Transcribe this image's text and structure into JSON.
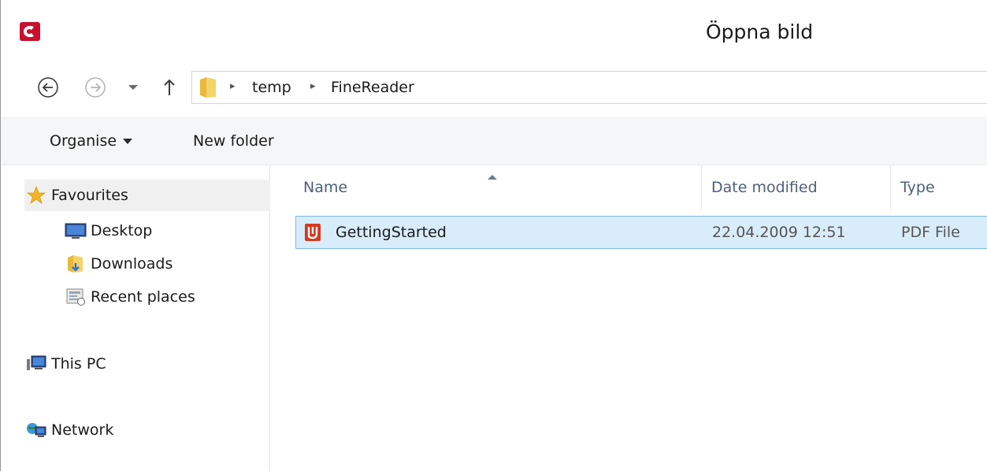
{
  "window": {
    "title": "Öppna bild"
  },
  "address": {
    "crumbs": [
      "temp",
      "FineReader"
    ]
  },
  "toolbar": {
    "organise_label": "Organise",
    "new_folder_label": "New folder"
  },
  "navpane": {
    "favourites": "Favourites",
    "desktop": "Desktop",
    "downloads": "Downloads",
    "recent": "Recent places",
    "this_pc": "This PC",
    "network": "Network"
  },
  "columns": {
    "name": "Name",
    "date": "Date modified",
    "type": "Type"
  },
  "files": [
    {
      "name": "GettingStarted",
      "date": "22.04.2009 12:51",
      "type": "PDF File"
    }
  ],
  "colors": {
    "selection_bg": "#d9ecfa",
    "selection_border": "#7ab8e8",
    "header_text": "#4c607a",
    "app_icon": "#c8102e"
  }
}
